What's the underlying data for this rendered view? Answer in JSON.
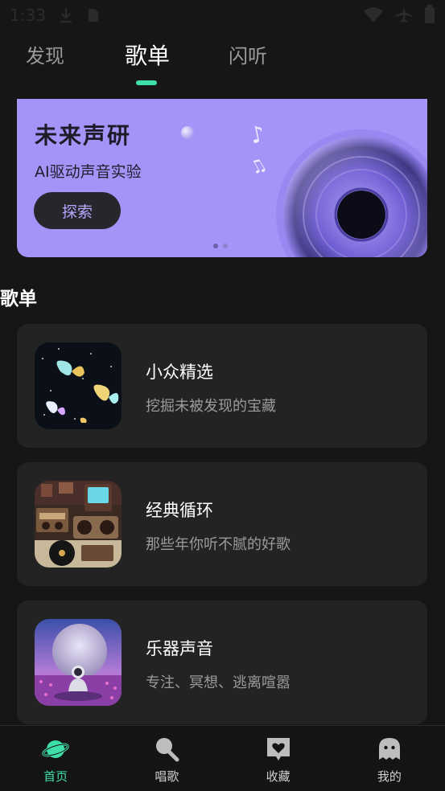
{
  "status_bar": {
    "time": "1:33"
  },
  "top_tabs": [
    {
      "label": "发现",
      "active": false
    },
    {
      "label": "歌单",
      "active": true
    },
    {
      "label": "闪听",
      "active": false
    }
  ],
  "banner": {
    "title": "未来声研",
    "subtitle": "AI驱动声音实验",
    "button_label": "探索",
    "background": "#a594f8"
  },
  "section_title": "歌单",
  "playlists": [
    {
      "title": "小众精选",
      "desc": "挖掘未被发现的宝藏",
      "cover": "butterfly-cover"
    },
    {
      "title": "经典循环",
      "desc": "那些年你听不腻的好歌",
      "cover": "retro-radio-cover"
    },
    {
      "title": "乐器声音",
      "desc": "专注、冥想、逃离喧嚣",
      "cover": "astronaut-moon-cover"
    }
  ],
  "bottom_nav": [
    {
      "label": "首页",
      "icon": "planet-icon",
      "active": true
    },
    {
      "label": "唱歌",
      "icon": "microphone-icon",
      "active": false
    },
    {
      "label": "收藏",
      "icon": "heart-box-icon",
      "active": false
    },
    {
      "label": "我的",
      "icon": "ghost-icon",
      "active": false
    }
  ],
  "colors": {
    "accent": "#3ee0a8",
    "background": "#161616",
    "card": "#232323"
  }
}
